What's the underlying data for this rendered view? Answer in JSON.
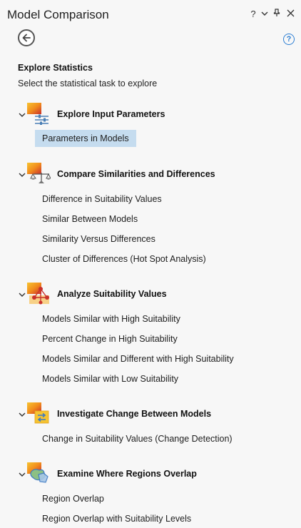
{
  "window": {
    "title": "Model Comparison",
    "controls": {
      "help": "?",
      "menu": "⌄",
      "pin": "⊥",
      "close": "✕"
    }
  },
  "header": {
    "heading": "Explore Statistics",
    "subheading": "Select the statistical task to explore"
  },
  "groups": [
    {
      "label": "Explore Input Parameters",
      "icon": "sliders-icon",
      "items": [
        {
          "label": "Parameters in Models",
          "selected": true
        }
      ]
    },
    {
      "label": "Compare Similarities and Differences",
      "icon": "balance-scale-icon",
      "items": [
        {
          "label": "Difference in Suitability Values"
        },
        {
          "label": "Similar Between Models"
        },
        {
          "label": "Similarity Versus Differences"
        },
        {
          "label": "Cluster of Differences (Hot Spot Analysis)"
        }
      ]
    },
    {
      "label": "Analyze Suitability Values",
      "icon": "network-nodes-icon",
      "items": [
        {
          "label": "Models Similar with High Suitability"
        },
        {
          "label": "Percent Change in High Suitability"
        },
        {
          "label": "Models Similar and Different with High Suitability"
        },
        {
          "label": "Models Similar with Low Suitability"
        }
      ]
    },
    {
      "label": "Investigate Change Between Models",
      "icon": "change-arrows-icon",
      "items": [
        {
          "label": "Change in Suitability Values (Change Detection)"
        }
      ]
    },
    {
      "label": "Examine Where Regions Overlap",
      "icon": "region-overlap-icon",
      "items": [
        {
          "label": "Region Overlap"
        },
        {
          "label": "Region Overlap with Suitability Levels"
        }
      ]
    }
  ],
  "colors": {
    "accent": "#2d7fd3",
    "selection": "#c5dcef",
    "icon_orange": "#f28c1c",
    "icon_red": "#c9302c",
    "icon_yellow": "#f6c431"
  }
}
